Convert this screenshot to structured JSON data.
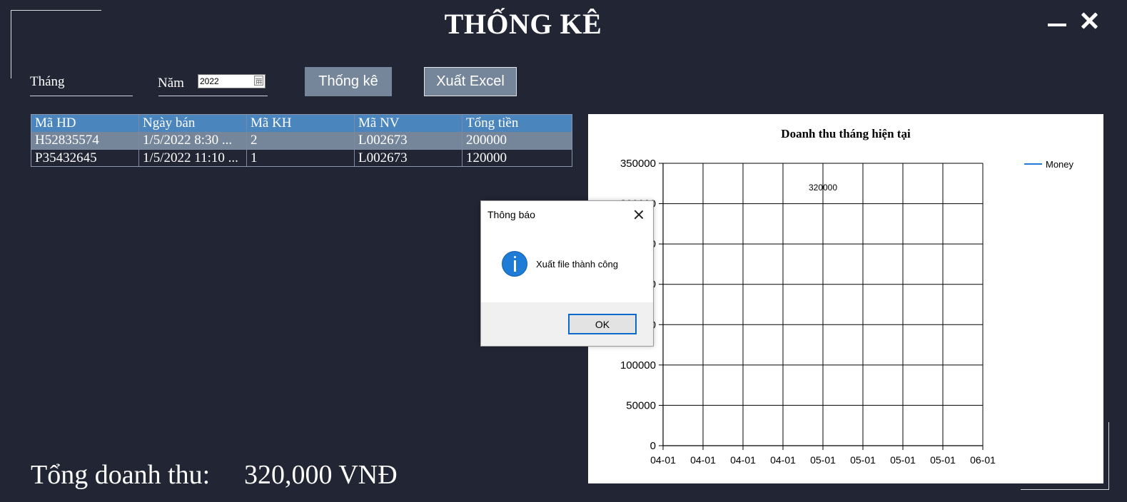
{
  "window": {
    "title": "THỐNG KÊ"
  },
  "filters": {
    "month_label": "Tháng",
    "year_label": "Năm",
    "year_value": "2022",
    "stats_button": "Thống kê",
    "export_button": "Xuất Excel"
  },
  "table": {
    "columns": [
      "Mã HD",
      "Ngày bán",
      "Mã KH",
      "Mã NV",
      "Tổng tiền"
    ],
    "rows": [
      [
        "H52835574",
        "1/5/2022 8:30 ...",
        "2",
        "L002673",
        "200000"
      ],
      [
        "P35432645",
        "1/5/2022 11:10 ...",
        "1",
        "L002673",
        "120000"
      ]
    ]
  },
  "summary": {
    "label": "Tổng doanh thu:",
    "value": "320,000 VNĐ"
  },
  "chart_data": {
    "type": "line",
    "title": "Doanh thu tháng hiện tại",
    "x_tick_labels": [
      "04-01",
      "04-01",
      "04-01",
      "04-01",
      "05-01",
      "05-01",
      "05-01",
      "05-01",
      "06-01"
    ],
    "y_tick_labels": [
      "350000",
      "300000",
      "250000",
      "200000",
      "150000",
      "100000",
      "50000",
      "0"
    ],
    "ylim": [
      0,
      350000
    ],
    "series": [
      {
        "name": "Money",
        "color": "#1e7bd6",
        "values": [
          320000
        ]
      }
    ],
    "data_labels": [
      "320000"
    ],
    "legend_position": "top-right",
    "grid": true
  },
  "dialog": {
    "title": "Thông báo",
    "message": "Xuất file thành công",
    "ok_label": "OK",
    "icon": "info-icon"
  }
}
